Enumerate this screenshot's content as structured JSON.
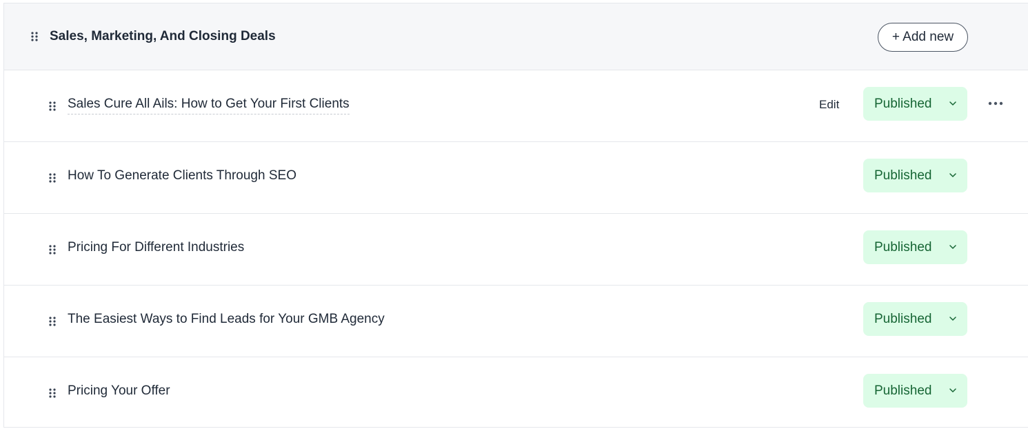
{
  "module": {
    "title": "Sales, Marketing, And Closing Deals",
    "add_button_label": "+ Add new"
  },
  "lessons": [
    {
      "title": "Sales Cure All Ails: How to Get Your First Clients",
      "status": "Published",
      "edit_label": "Edit",
      "hovered": true
    },
    {
      "title": "How To Generate Clients Through SEO",
      "status": "Published"
    },
    {
      "title": "Pricing For Different Industries",
      "status": "Published"
    },
    {
      "title": "The Easiest Ways to Find Leads for Your GMB Agency",
      "status": "Published"
    },
    {
      "title": "Pricing Your Offer",
      "status": "Published"
    }
  ],
  "icons": {
    "drag_handle": "drag-handle-icon",
    "chevron": "chevron-down-icon",
    "more": "more-horizontal-icon"
  },
  "colors": {
    "header_bg": "#f6f7f9",
    "status_bg": "#dcfce7",
    "status_text": "#166534",
    "border": "#e5e7eb"
  }
}
